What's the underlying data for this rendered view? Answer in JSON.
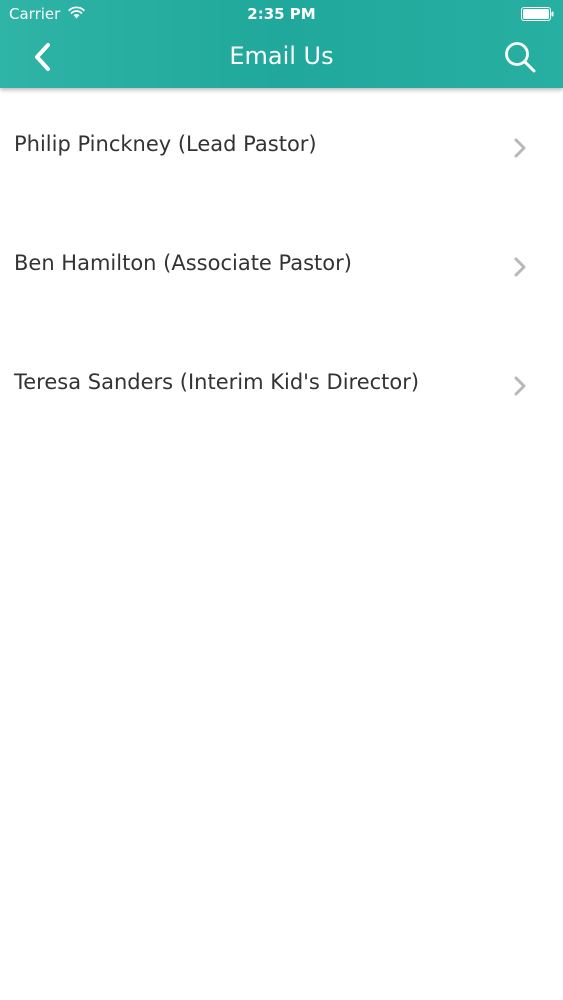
{
  "status_bar": {
    "carrier": "Carrier",
    "time": "2:35 PM",
    "wifi_icon": "wifi-icon",
    "battery_icon": "battery-icon"
  },
  "nav_bar": {
    "title": "Email Us",
    "back_icon": "chevron-left-icon",
    "search_icon": "search-icon",
    "background_color": "#22aa9c",
    "text_color": "#ffffff"
  },
  "contacts": [
    {
      "label": "Philip Pinckney (Lead Pastor)"
    },
    {
      "label": "Ben Hamilton (Associate Pastor)"
    },
    {
      "label": "Teresa Sanders (Interim Kid's Director)"
    }
  ],
  "colors": {
    "text": "#333333",
    "chevron": "#b8b8b8",
    "background": "#ffffff"
  }
}
